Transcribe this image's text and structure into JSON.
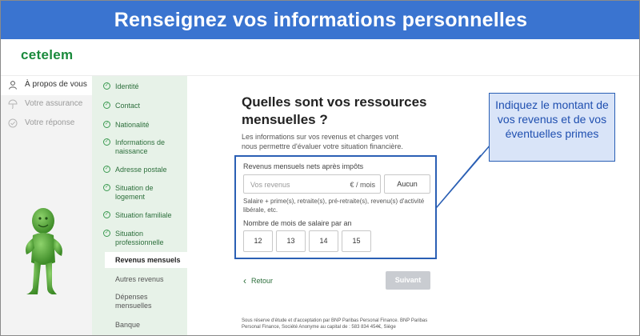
{
  "banner": {
    "title": "Renseignez vos informations personnelles"
  },
  "header": {
    "logo": "cetelem"
  },
  "leftnav": {
    "items": [
      {
        "label": "À propos de vous",
        "icon": "person-icon",
        "active": true
      },
      {
        "label": "Votre assurance",
        "icon": "umbrella-icon",
        "active": false
      },
      {
        "label": "Votre réponse",
        "icon": "check-circle-icon",
        "active": false
      }
    ]
  },
  "steps": {
    "completed": [
      "Identité",
      "Contact",
      "Nationalité",
      "Informations de naissance",
      "Adresse postale",
      "Situation de logement",
      "Situation familiale",
      "Situation professionnelle"
    ],
    "current": "Revenus mensuels",
    "upcoming": [
      "Autres revenus",
      "Dépenses mensuelles",
      "Banque"
    ]
  },
  "main": {
    "question": "Quelles sont vos ressources mensuelles ?",
    "intro": "Les informations sur vos revenus et charges vont nous permettre d'évaluer votre situation financière.",
    "revenus_label": "Revenus mensuels nets après impôts",
    "revenus_placeholder": "Vos revenus",
    "revenus_unit": "€ / mois",
    "aucun_label": "Aucun",
    "revenus_help": "Salaire + prime(s), retraite(s), pré-retraite(s), revenu(s) d'activité libérale, etc.",
    "mois_label": "Nombre de mois de salaire par an",
    "mois_options": [
      "12",
      "13",
      "14",
      "15"
    ],
    "retour_label": "Retour",
    "suivant_label": "Suivant",
    "footnote": "Sous réserve d'étude et d'acceptation par BNP Paribas Personal Finance. BNP Paribas Personal Finance, Société Anonyme au capital de : 583 834 454€, Siège"
  },
  "callout": {
    "text": "Indiquez le montant de vos revenus et de vos éventuelles primes"
  },
  "colors": {
    "banner": "#3a74d0",
    "brand_green": "#1a8a3c",
    "highlight_border": "#2a5fb4",
    "callout_bg": "#d9e4f8"
  }
}
